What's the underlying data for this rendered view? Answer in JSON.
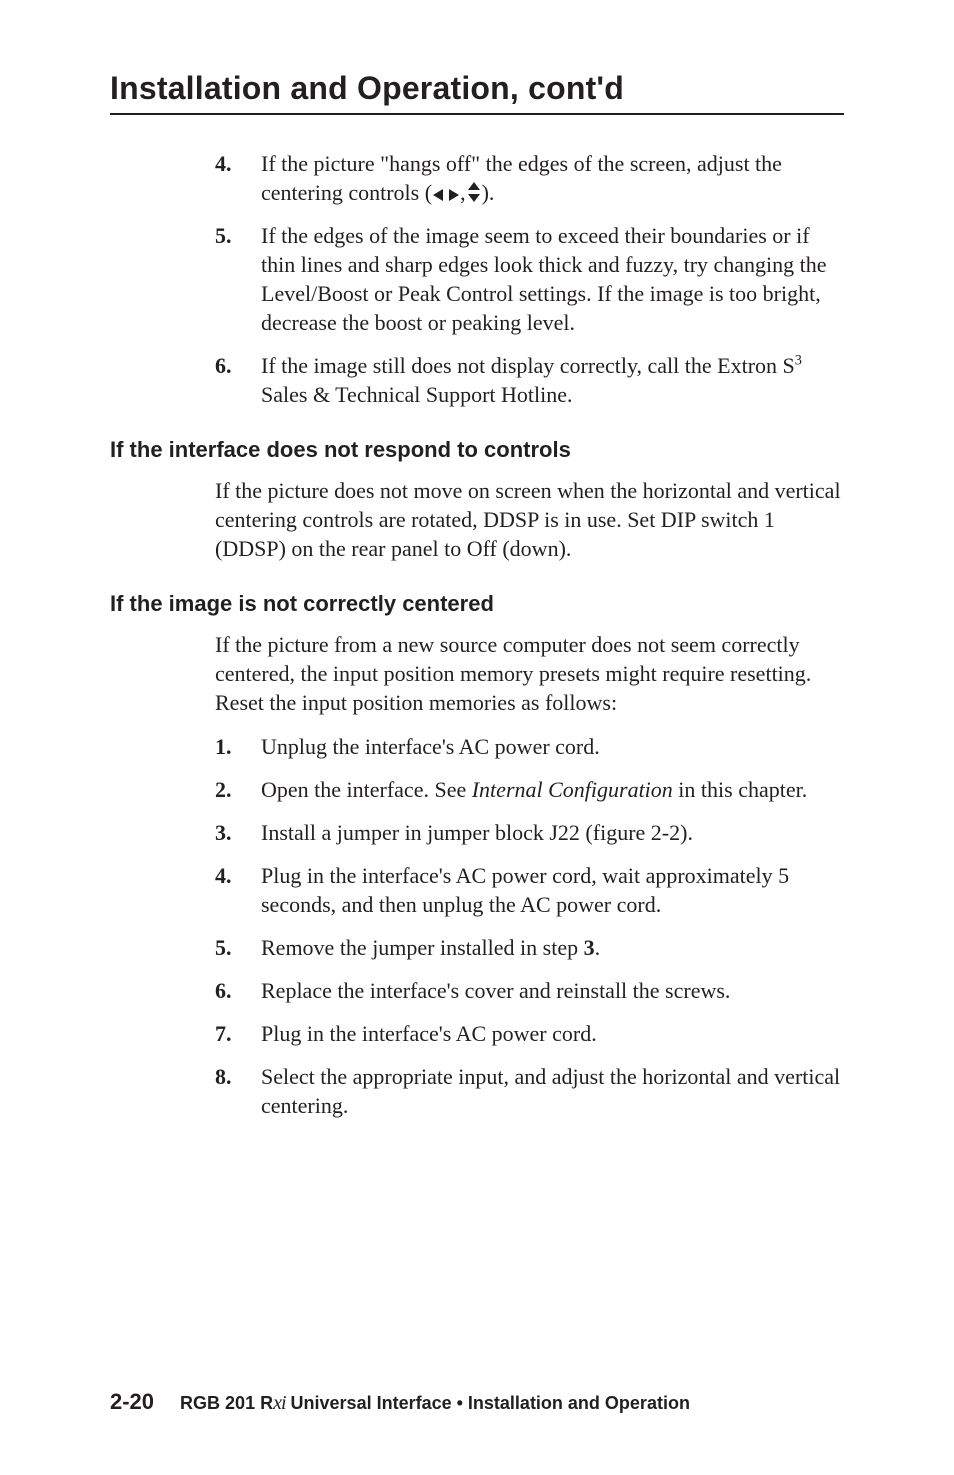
{
  "running_head": "Installation and Operation, cont'd",
  "list1": [
    {
      "n": "4.",
      "t_before": "If the picture \"hangs off\" the edges of the screen, adjust the centering controls (",
      "t_after": ")."
    },
    {
      "n": "5.",
      "t": "If the edges of the image seem to exceed their boundaries or if thin lines and sharp edges look thick and fuzzy, try changing the Level/Boost or Peak Control settings.  If the image is too bright, decrease the boost or peaking level."
    },
    {
      "n": "6.",
      "t_before": "If the image still does not display correctly, call the Extron S",
      "sup": "3",
      "t_after": " Sales & Technical Support Hotline."
    }
  ],
  "sec1_head": "If the interface does not respond to controls",
  "sec1_para": "If the picture does not move on screen when the horizontal and vertical centering controls are rotated, DDSP is in use.  Set DIP switch 1 (DDSP) on the rear panel to Off (down).",
  "sec2_head": "If the image is not correctly centered",
  "sec2_para": "If the picture from a new source computer does not seem correctly centered, the input position memory presets might require resetting.  Reset the input position memories as follows:",
  "list2": [
    {
      "n": "1.",
      "t": "Unplug the interface's AC power cord."
    },
    {
      "n": "2.",
      "t_before": "Open the interface.  See ",
      "italic": "Internal Configuration",
      "t_after": " in this chapter."
    },
    {
      "n": "3.",
      "t": "Install a jumper in jumper block J22 (figure 2-2)."
    },
    {
      "n": "4.",
      "t": "Plug in the interface's AC power cord, wait approximately 5 seconds, and then unplug the AC power cord."
    },
    {
      "n": "5.",
      "t_before": "Remove the jumper installed in step ",
      "bold": "3",
      "t_after": "."
    },
    {
      "n": "6.",
      "t": "Replace the interface's cover and reinstall the screws."
    },
    {
      "n": "7.",
      "t": "Plug in the interface's AC power cord."
    },
    {
      "n": "8.",
      "t": "Select the appropriate input, and adjust the horizontal and vertical centering."
    }
  ],
  "footer": {
    "pageno": "2-20",
    "product_prefix": "RGB 201 R",
    "product_script": "xi",
    "rest": " Universal Interface • Installation and Operation"
  }
}
